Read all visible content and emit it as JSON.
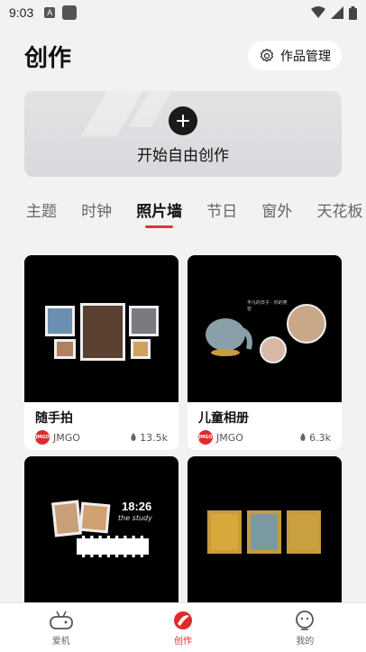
{
  "status": {
    "time": "9:03",
    "notif_letter": "A"
  },
  "header": {
    "title": "创作",
    "manage_label": "作品管理"
  },
  "create": {
    "label": "开始自由创作"
  },
  "tabs": [
    {
      "label": "主题"
    },
    {
      "label": "时钟"
    },
    {
      "label": "照片墙"
    },
    {
      "label": "节日"
    },
    {
      "label": "窗外"
    },
    {
      "label": "天花板"
    }
  ],
  "active_tab": "照片墙",
  "cards": [
    {
      "name": "随手拍",
      "author": "JMGO",
      "likes": "13.5k"
    },
    {
      "name": "儿童相册",
      "author": "JMGO",
      "likes": "6.3k"
    },
    {
      "name": "",
      "author": "",
      "likes": ""
    },
    {
      "name": "",
      "author": "",
      "likes": ""
    }
  ],
  "card3_clock": {
    "time": "18:26",
    "caption": "the study"
  },
  "card2_note": "平凡的日子 · 你的笑容",
  "bottom_nav": [
    {
      "label": "爱机",
      "icon": "tv-icon"
    },
    {
      "label": "创作",
      "icon": "create-icon"
    },
    {
      "label": "我的",
      "icon": "profile-icon"
    }
  ],
  "colors": {
    "accent": "#e02a2a",
    "background": "#f2f2f2"
  }
}
